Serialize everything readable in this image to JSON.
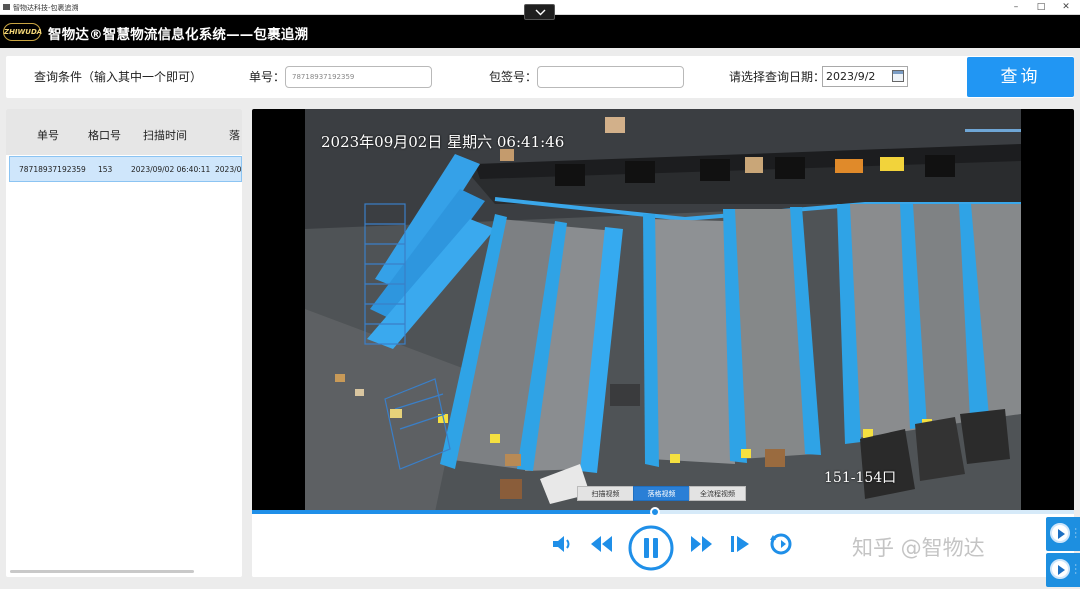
{
  "window": {
    "title": "智物达科技-包裹追溯"
  },
  "header": {
    "logo_text": "ZHIWUDA",
    "system_title": "智物达®智慧物流信息化系统——包裹追溯"
  },
  "query": {
    "conditions_label": "查询条件（输入其中一个即可）",
    "order_label": "单号：",
    "order_value": "78718937192359",
    "bag_label": "包签号：",
    "bag_value": "",
    "date_label": "请选择查询日期：",
    "date_value": "2023/9/2",
    "query_button": "查询"
  },
  "list": {
    "columns": [
      "单号",
      "格口号",
      "扫描时间",
      "落"
    ],
    "rows": [
      {
        "order": "78718937192359",
        "port": "153",
        "scan_time": "2023/09/02 06:40:11",
        "drop_time": "2023/0"
      }
    ]
  },
  "video": {
    "osd_timestamp": "2023年09月02日 星期六 06:41:46",
    "osd_port_label": "151-154口",
    "tabs": [
      {
        "label": "扫描视频",
        "active": false
      },
      {
        "label": "落格视频",
        "active": true
      },
      {
        "label": "全流程视频",
        "active": false
      }
    ],
    "progress_fraction": 0.49,
    "controls": [
      "volume-icon",
      "rewind-icon",
      "pause-icon",
      "fast-forward-icon",
      "next-frame-icon",
      "replay-icon"
    ]
  },
  "watermark": "知乎 @智物达",
  "colors": {
    "accent": "#2196f3",
    "header_bg": "#000000",
    "selected_row": "#cfe6fb",
    "chute_blue": "#2fa3e6"
  }
}
